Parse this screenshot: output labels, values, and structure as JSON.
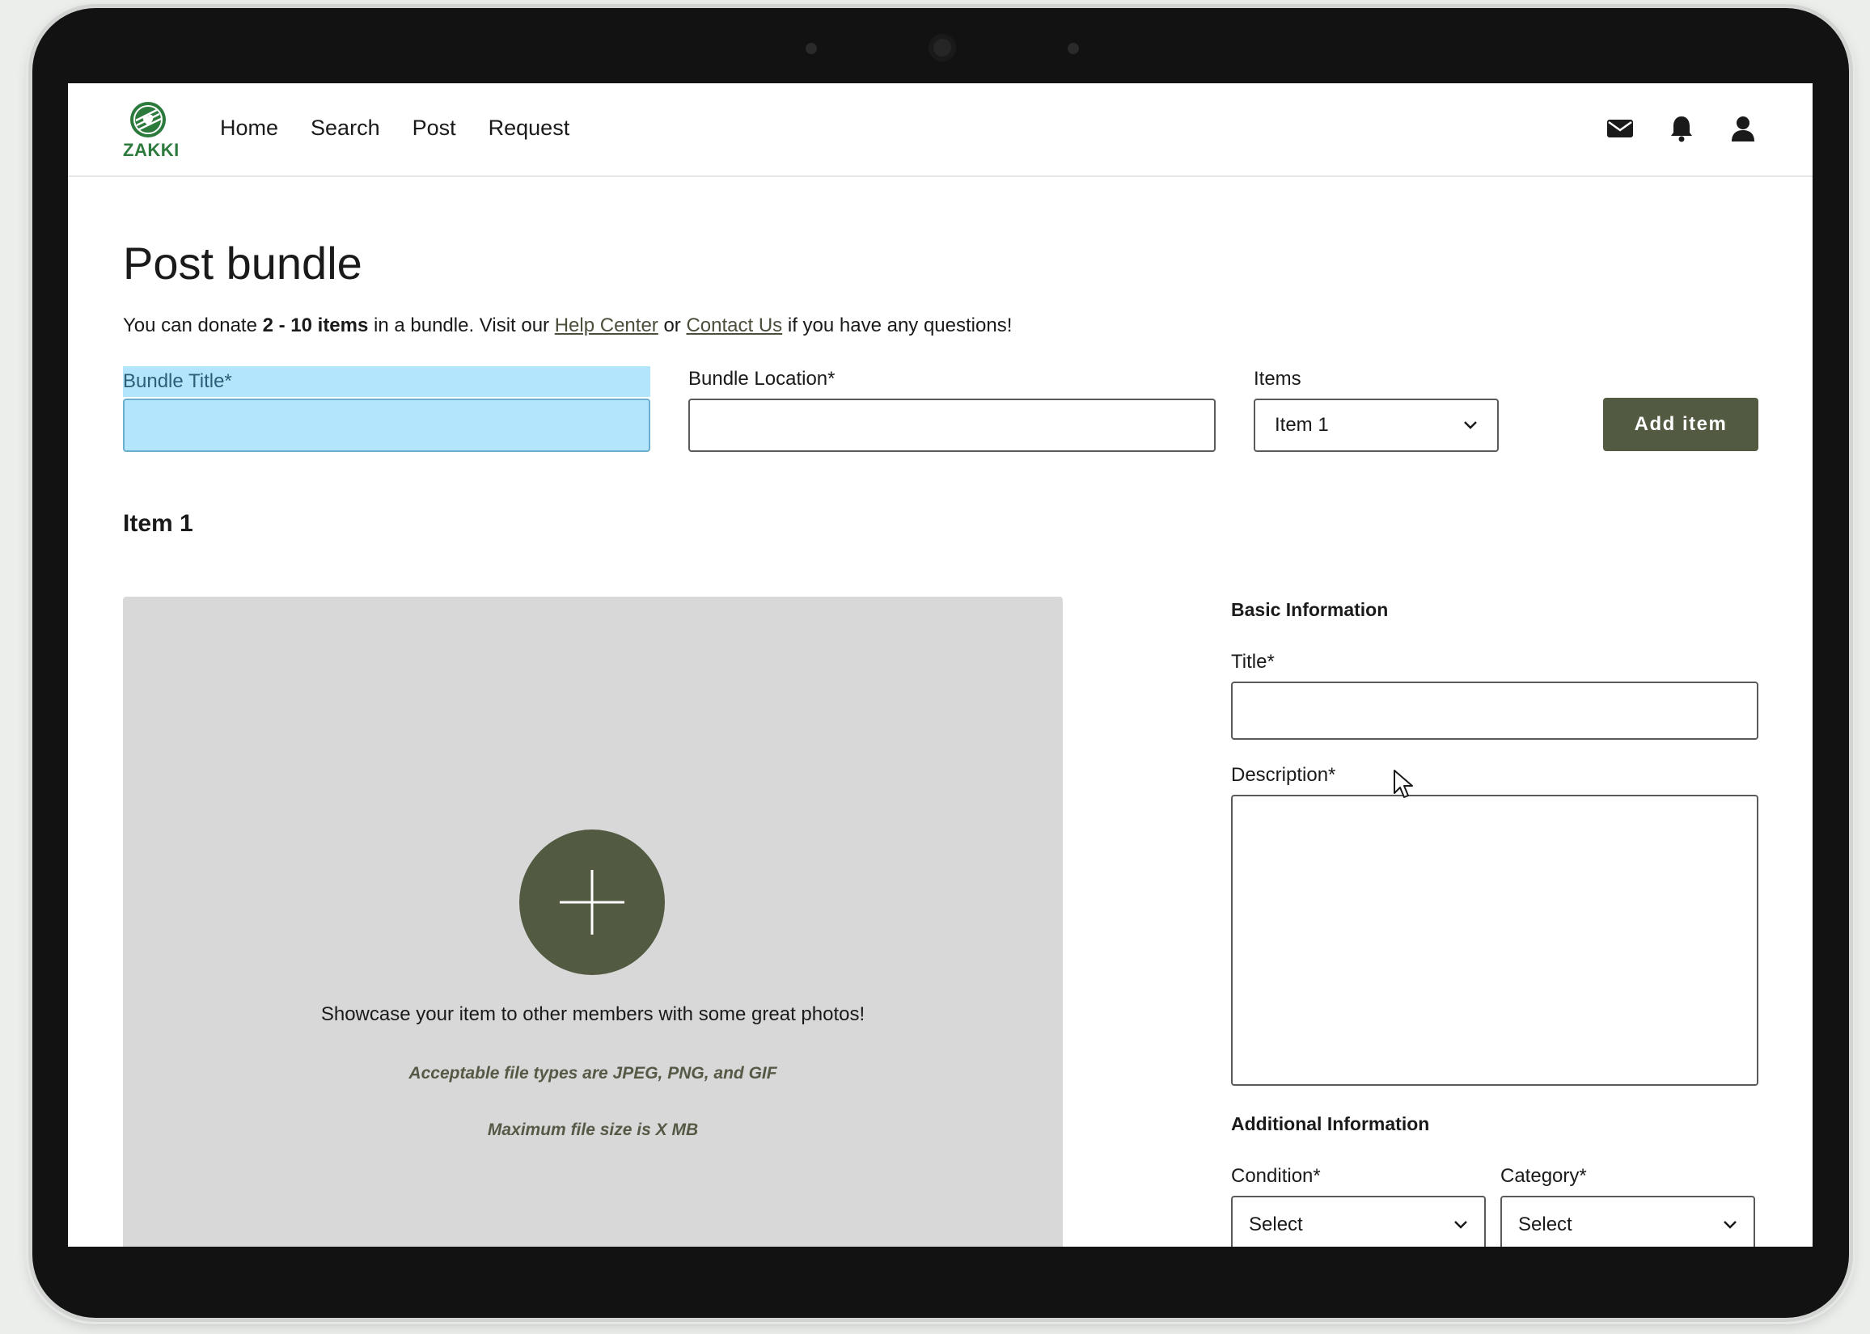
{
  "header": {
    "logo_text": "ZAKKI",
    "nav": [
      "Home",
      "Search",
      "Post",
      "Request"
    ],
    "icons": [
      "mail-icon",
      "bell-icon",
      "user-icon"
    ]
  },
  "page": {
    "title": "Post bundle",
    "intro": {
      "pre": "You can donate ",
      "bold": "2 - 10 items",
      "mid": " in a bundle. Visit our ",
      "help_link": "Help Center",
      "or": " or ",
      "contact_link": "Contact Us",
      "post": " if you have any questions!"
    }
  },
  "bundle_form": {
    "title_label": "Bundle Title*",
    "title_value": "",
    "location_label": "Bundle Location*",
    "location_value": "",
    "items_label": "Items",
    "items_selected": "Item 1",
    "add_button": "Add item"
  },
  "item": {
    "heading": "Item 1",
    "upload": {
      "message": "Showcase your item to other members with some great photos!",
      "file_types": "Acceptable file types are JPEG, PNG, and GIF",
      "max_size": "Maximum file size is X MB"
    },
    "basic_info": {
      "heading": "Basic Information",
      "title_label": "Title*",
      "title_value": "",
      "description_label": "Description*",
      "description_value": ""
    },
    "additional_info": {
      "heading": "Additional Information",
      "condition_label": "Condition*",
      "condition_selected": "Select",
      "category_label": "Category*",
      "category_selected": "Select"
    }
  },
  "colors": {
    "accent": "#525a42",
    "focus_highlight": "#b3e5fc",
    "upload_bg": "#d8d8d8",
    "logo_green": "#2c7a3c"
  }
}
